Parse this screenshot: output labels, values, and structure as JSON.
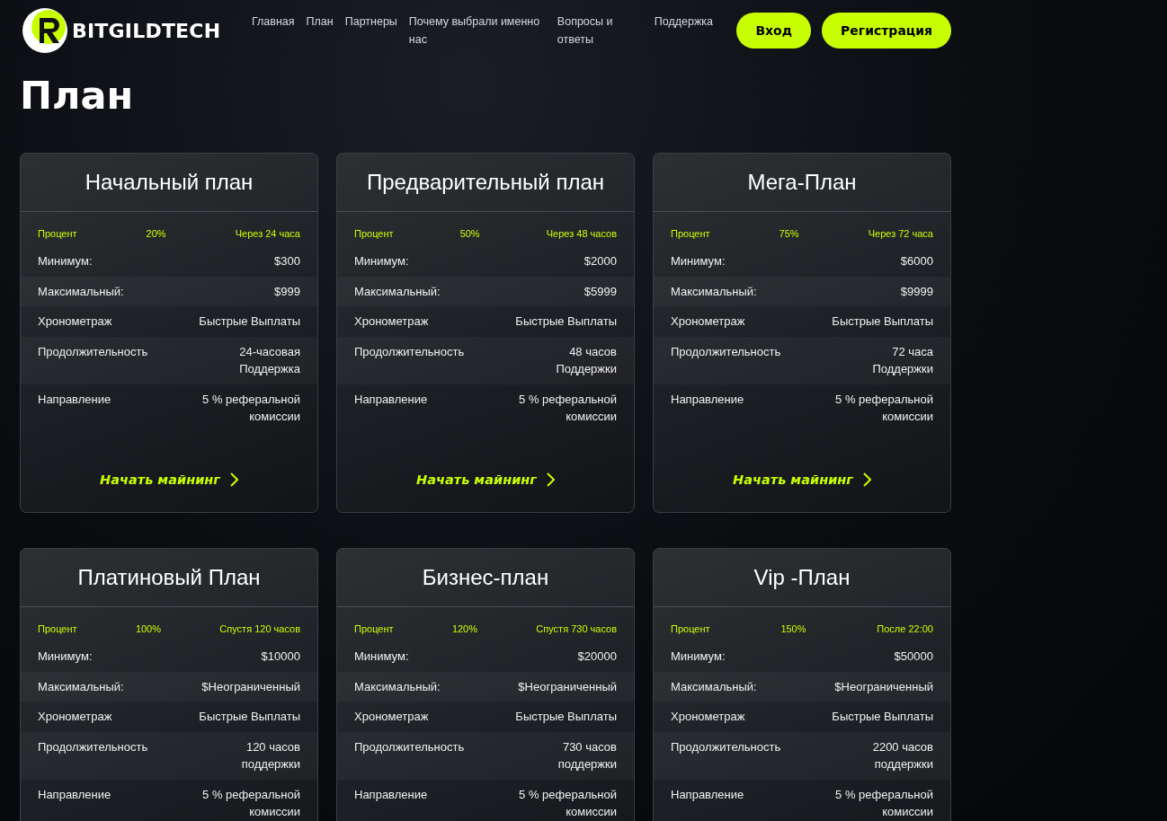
{
  "header": {
    "logo_text": "BITGILDTECH",
    "nav": [
      "Главная",
      "План",
      "Партнеры",
      "Почему выбрали именно нас",
      "Вопросы и ответы",
      "Поддержка"
    ],
    "buttons": [
      {
        "label": "Вход"
      },
      {
        "label": "Регистрация"
      }
    ]
  },
  "page_title": "План",
  "plans": [
    {
      "title": "Начальный план",
      "percent_label": "Процент",
      "percent": "20%",
      "period": "Через 24 часа",
      "rows": [
        {
          "label": "Минимум:",
          "value": "$300"
        },
        {
          "label": "Максимальный:",
          "value": "$999"
        },
        {
          "label": "Хронометраж",
          "value": "Быстрые Выплаты"
        },
        {
          "label": "Продолжительность",
          "value": "24-часовая\nПоддержка"
        },
        {
          "label": "Направление",
          "value": "5 % реферальной\nкомиссии"
        }
      ],
      "cta": "Начать майнинг"
    },
    {
      "title": "Предварительный план",
      "percent_label": "Процент",
      "percent": "50%",
      "period": "Через 48 часов",
      "rows": [
        {
          "label": "Минимум:",
          "value": "$2000"
        },
        {
          "label": "Максимальный:",
          "value": "$5999"
        },
        {
          "label": "Хронометраж",
          "value": "Быстрые Выплаты"
        },
        {
          "label": "Продолжительность",
          "value": "48 часов\nПоддержки"
        },
        {
          "label": "Направление",
          "value": "5 % реферальной\nкомиссии"
        }
      ],
      "cta": "Начать майнинг"
    },
    {
      "title": "Мега-План",
      "percent_label": "Процент",
      "percent": "75%",
      "period": "Через 72 часа",
      "rows": [
        {
          "label": "Минимум:",
          "value": "$6000"
        },
        {
          "label": "Максимальный:",
          "value": "$9999"
        },
        {
          "label": "Хронометраж",
          "value": "Быстрые Выплаты"
        },
        {
          "label": "Продолжительность",
          "value": "72 часа\nПоддержки"
        },
        {
          "label": "Направление",
          "value": "5 % реферальной\nкомиссии"
        }
      ],
      "cta": "Начать майнинг"
    },
    {
      "title": "Платиновый План",
      "percent_label": "Процент",
      "percent": "100%",
      "period": "Спустя 120 часов",
      "rows": [
        {
          "label": "Минимум:",
          "value": "$10000"
        },
        {
          "label": "Максимальный:",
          "value": "$Неограниченный"
        },
        {
          "label": "Хронометраж",
          "value": "Быстрые Выплаты"
        },
        {
          "label": "Продолжительность",
          "value": "120 часов\nподдержки"
        },
        {
          "label": "Направление",
          "value": "5 % реферальной\nкомиссии"
        }
      ]
    },
    {
      "title": "Бизнес-план",
      "percent_label": "Процент",
      "percent": "120%",
      "period": "Спустя 730 часов",
      "rows": [
        {
          "label": "Минимум:",
          "value": "$20000"
        },
        {
          "label": "Максимальный:",
          "value": "$Неограниченный"
        },
        {
          "label": "Хронометраж",
          "value": "Быстрые Выплаты"
        },
        {
          "label": "Продолжительность",
          "value": "730 часов\nподдержки"
        },
        {
          "label": "Направление",
          "value": "5 % реферальной\nкомиссии"
        }
      ]
    },
    {
      "title": "Vip -План",
      "percent_label": "Процент",
      "percent": "150%",
      "period": "После 22:00",
      "rows": [
        {
          "label": "Минимум:",
          "value": "$50000"
        },
        {
          "label": "Максимальный:",
          "value": "$Неограниченный"
        },
        {
          "label": "Хронометраж",
          "value": "Быстрые Выплаты"
        },
        {
          "label": "Продолжительность",
          "value": "2200 часов\nподдержки"
        },
        {
          "label": "Направление",
          "value": "5 % реферальной\nкомиссии"
        }
      ]
    }
  ]
}
